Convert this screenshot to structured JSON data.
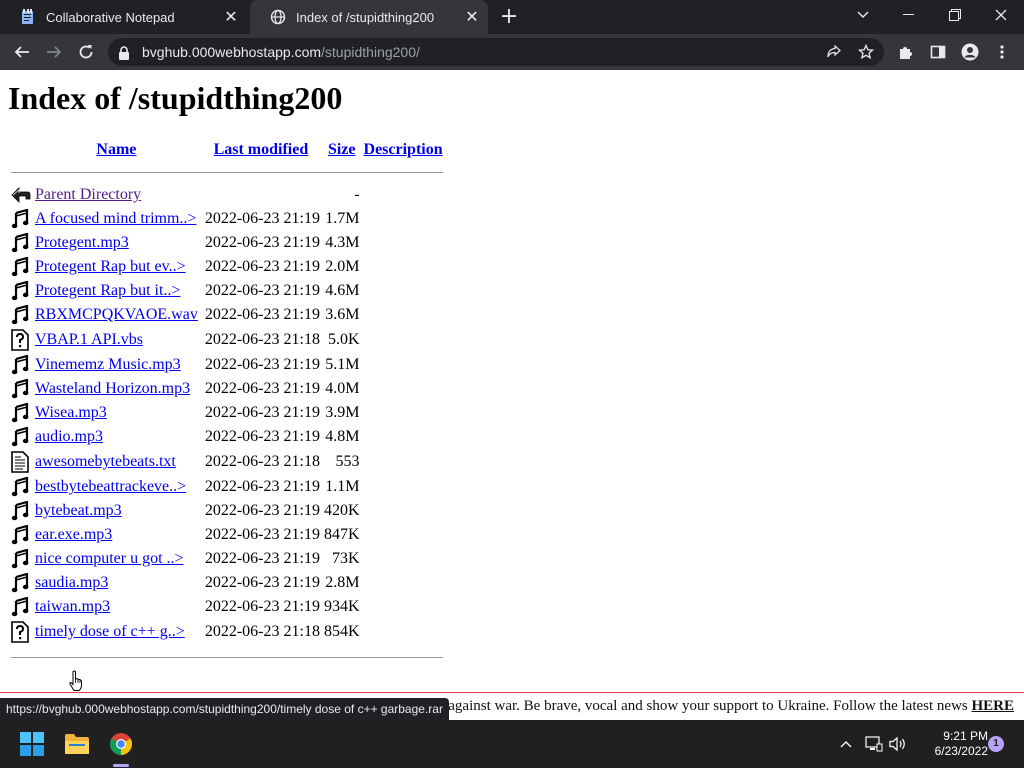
{
  "browser": {
    "tabs": [
      {
        "title": "Collaborative Notepad",
        "icon": "notepad-icon",
        "active": false
      },
      {
        "title": "Index of /stupidthing200",
        "icon": "globe-icon",
        "active": true
      }
    ],
    "url_host": "bvghub.000webhostapp.com",
    "url_path": "/stupidthing200/",
    "status_url": "https://bvghub.000webhostapp.com/stupidthing200/timely dose of c++ garbage.rar"
  },
  "page": {
    "title": "Index of /stupidthing200",
    "columns": {
      "name": "Name",
      "last_modified": "Last modified",
      "size": "Size",
      "description": "Description"
    },
    "parent": {
      "name": "Parent Directory",
      "size": "-"
    },
    "rows": [
      {
        "icon": "music-icon",
        "name": "A focused mind trimm..>",
        "date": "2022-06-23 21:19",
        "size": "1.7M"
      },
      {
        "icon": "music-icon",
        "name": "Protegent.mp3",
        "date": "2022-06-23 21:19",
        "size": "4.3M"
      },
      {
        "icon": "music-icon",
        "name": "Protegent Rap but ev..>",
        "date": "2022-06-23 21:19",
        "size": "2.0M"
      },
      {
        "icon": "music-icon",
        "name": "Protegent Rap but it..>",
        "date": "2022-06-23 21:19",
        "size": "4.6M"
      },
      {
        "icon": "music-icon",
        "name": "RBXMCPQKVAOE.wav",
        "date": "2022-06-23 21:19",
        "size": "3.6M"
      },
      {
        "icon": "unknown-file-icon",
        "name": "VBAP.1 API.vbs",
        "date": "2022-06-23 21:18",
        "size": "5.0K"
      },
      {
        "icon": "music-icon",
        "name": "Vinememz Music.mp3",
        "date": "2022-06-23 21:19",
        "size": "5.1M"
      },
      {
        "icon": "music-icon",
        "name": "Wasteland Horizon.mp3",
        "date": "2022-06-23 21:19",
        "size": "4.0M"
      },
      {
        "icon": "music-icon",
        "name": "Wisea.mp3",
        "date": "2022-06-23 21:19",
        "size": "3.9M"
      },
      {
        "icon": "music-icon",
        "name": "audio.mp3",
        "date": "2022-06-23 21:19",
        "size": "4.8M"
      },
      {
        "icon": "text-file-icon",
        "name": "awesomebytebeats.txt",
        "date": "2022-06-23 21:18",
        "size": "553"
      },
      {
        "icon": "music-icon",
        "name": "bestbytebeattrackeve..>",
        "date": "2022-06-23 21:19",
        "size": "1.1M"
      },
      {
        "icon": "music-icon",
        "name": "bytebeat.mp3",
        "date": "2022-06-23 21:19",
        "size": "420K"
      },
      {
        "icon": "music-icon",
        "name": "ear.exe.mp3",
        "date": "2022-06-23 21:19",
        "size": "847K"
      },
      {
        "icon": "music-icon",
        "name": "nice computer u got ..>",
        "date": "2022-06-23 21:19",
        "size": "73K"
      },
      {
        "icon": "music-icon",
        "name": "saudia.mp3",
        "date": "2022-06-23 21:19",
        "size": "2.8M"
      },
      {
        "icon": "music-icon",
        "name": "taiwan.mp3",
        "date": "2022-06-23 21:19",
        "size": "934K"
      },
      {
        "icon": "unknown-file-icon",
        "name": "timely dose of c++ g..>",
        "date": "2022-06-23 21:18",
        "size": "854K"
      }
    ],
    "banner": {
      "text": "o act against war. Be brave, vocal and show your support to Ukraine. Follow the latest news",
      "link": "HERE"
    }
  },
  "taskbar": {
    "apps": [
      "start-icon",
      "file-explorer-icon",
      "chrome-icon"
    ],
    "time": "9:21 PM",
    "date": "6/23/2022",
    "notifications": "1"
  },
  "colors": {
    "link": "#0000ee",
    "visited": "#551a8b",
    "chrome_dark": "#202124",
    "chrome_toolbar": "#35363a",
    "accent": "#b6a3f7"
  }
}
